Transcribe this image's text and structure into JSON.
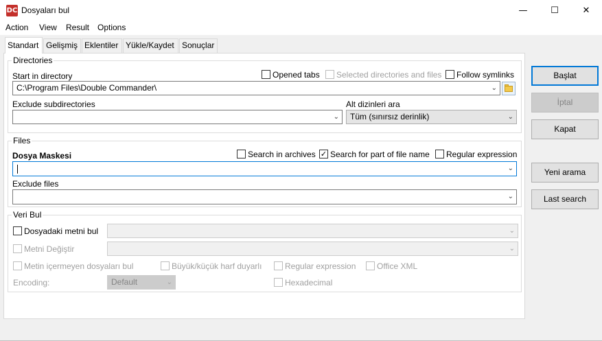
{
  "window": {
    "title": "Dosyaları bul",
    "icon_text": "DC",
    "controls": {
      "minimize": "—",
      "maximize": "☐",
      "close": "✕"
    }
  },
  "menu": [
    "Action",
    "View",
    "Result",
    "Options"
  ],
  "tabs": [
    "Standart",
    "Gelişmiş",
    "Eklentiler",
    "Yükle/Kaydet",
    "Sonuçlar"
  ],
  "directories": {
    "group_label": "Directories",
    "start_label": "Start in directory",
    "start_value": "C:\\Program Files\\Double Commander\\",
    "opened_tabs": "Opened tabs",
    "selected_dirs": "Selected directories and files",
    "follow_symlinks": "Follow symlinks",
    "exclude_label": "Exclude subdirectories",
    "exclude_value": "",
    "depth_label": "Alt dizinleri ara",
    "depth_value": "Tüm (sınırsız derinlik)"
  },
  "files": {
    "group_label": "Files",
    "mask_label": "Dosya Maskesi",
    "mask_value": "",
    "search_archives": "Search in archives",
    "search_part": "Search for part of file name",
    "search_part_checked": true,
    "regex": "Regular expression",
    "exclude_label": "Exclude files",
    "exclude_value": ""
  },
  "find_data": {
    "group_label": "Veri Bul",
    "find_text": "Dosyadaki metni bul",
    "replace_text": "Metni Değiştir",
    "not_containing": "Metin içermeyen dosyaları bul",
    "case_sensitive": "Büyük/küçük harf duyarlı",
    "regex": "Regular expression",
    "office_xml": "Office XML",
    "encoding_label": "Encoding:",
    "encoding_value": "Default",
    "hexadecimal": "Hexadecimal"
  },
  "buttons": {
    "start": "Başlat",
    "cancel": "İptal",
    "close": "Kapat",
    "new_search": "Yeni arama",
    "last_search": "Last search"
  },
  "accent_color": "#0078d7"
}
